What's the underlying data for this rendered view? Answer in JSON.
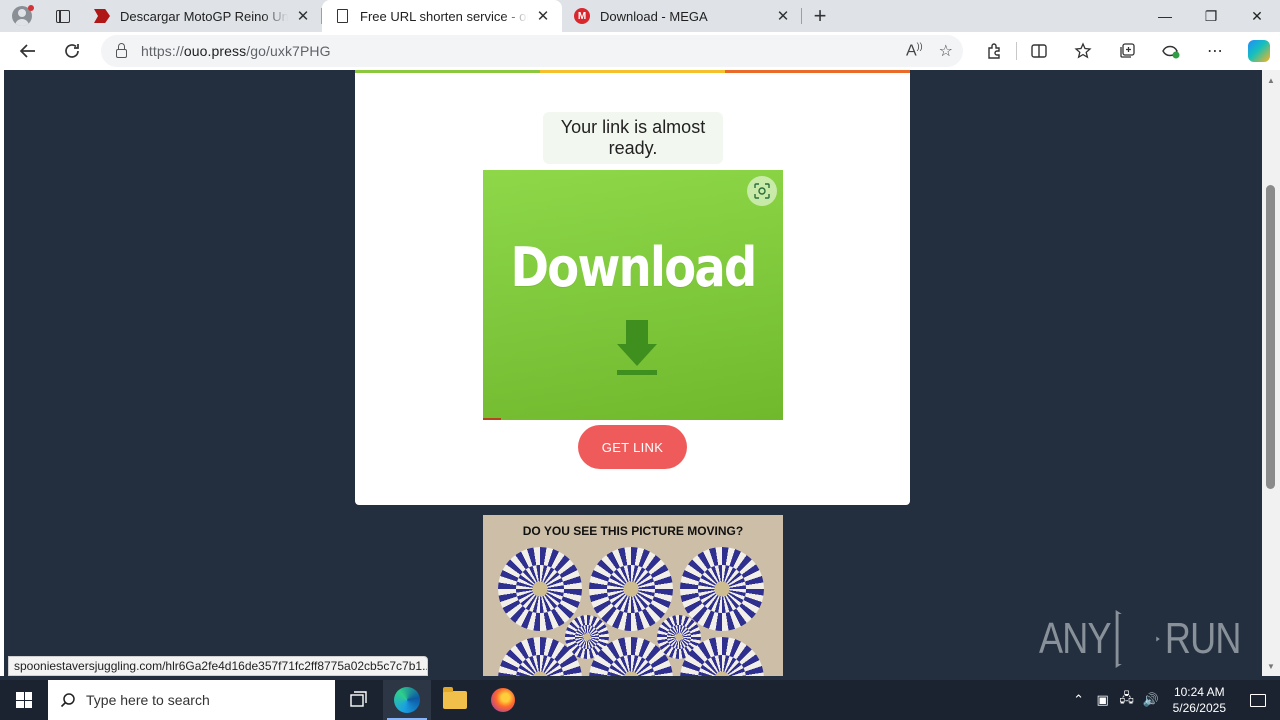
{
  "browser": {
    "tabs": [
      {
        "title": "Descargar MotoGP Reino Unido",
        "icon": "motogp-favicon",
        "active": false
      },
      {
        "title": "Free URL shorten service - ouo.press",
        "icon": "page-icon",
        "active": true
      },
      {
        "title": "Download - MEGA",
        "icon": "mega-icon",
        "active": false
      }
    ],
    "new_tab_symbol": "+",
    "close_symbol": "✕",
    "window_controls": {
      "minimize": "—",
      "restore": "❐",
      "close": "✕"
    },
    "address": {
      "prefix": "https://",
      "domain": "ouo.press",
      "path": "/go/uxk7PHG"
    }
  },
  "page": {
    "stripe_colors": [
      "#8dc63f",
      "#f5c02c",
      "#ea6a2a"
    ],
    "almost_ready_text": "Your link is almost ready.",
    "ad": {
      "headline": "Download",
      "background": "#7cca35"
    },
    "get_link_label": "GET LINK",
    "get_link_color": "#ef5b5b",
    "ad2": {
      "question": "DO YOU SEE THIS PICTURE MOVING?"
    },
    "status_bar_url": "spooniestaversjuggling.com/hlr6Ga2fe4d16de357f71fc2ff8775a02cb5c7c7b1...",
    "watermark": "ANY RUN"
  },
  "taskbar": {
    "search_placeholder": "Type here to search",
    "apps": [
      "task-view",
      "microsoft-edge",
      "file-explorer",
      "firefox"
    ],
    "clock_time": "10:24 AM",
    "clock_date": "5/26/2025"
  }
}
